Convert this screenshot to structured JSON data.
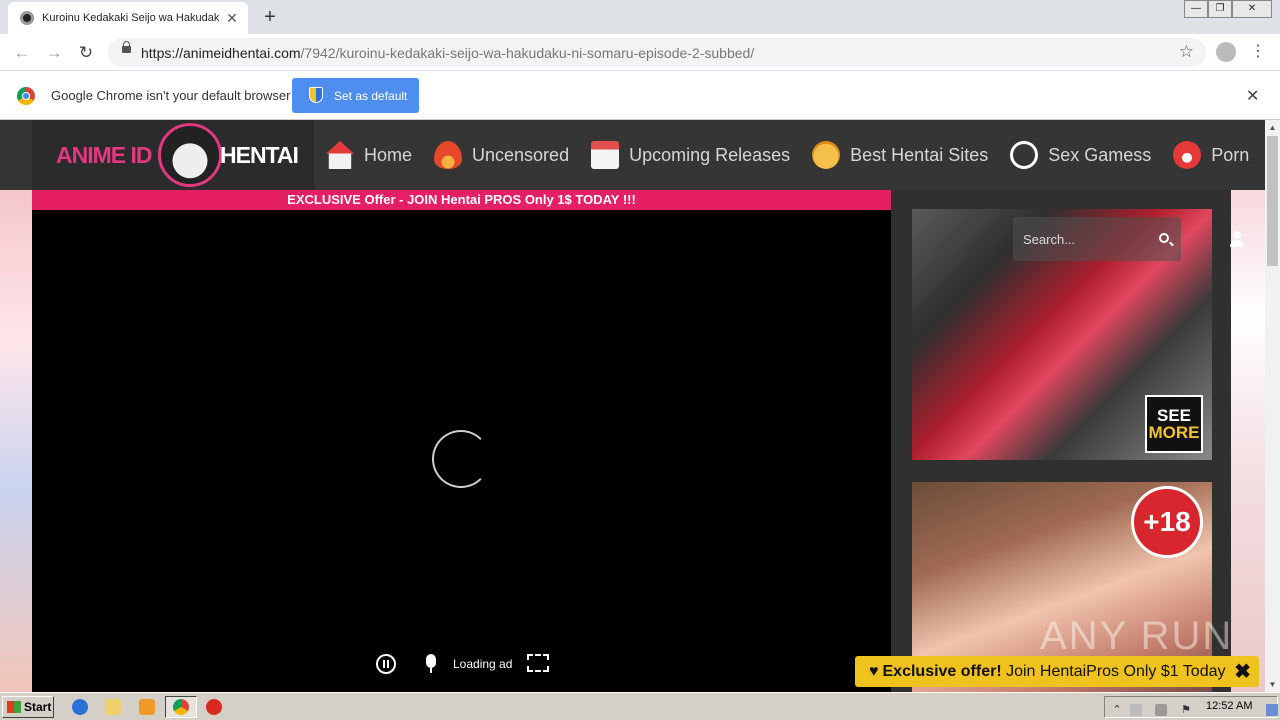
{
  "browser": {
    "tab_title": "Kuroinu Kedakaki Seijo wa Hakudaku ni Somaru",
    "tab_close": "✕",
    "new_tab": "+",
    "url_host": "https://animeidhentai.com",
    "url_path": "/7942/kuroinu-kedakaki-seijo-wa-hakudaku-ni-somaru-episode-2-subbed/",
    "back": "←",
    "forward": "→",
    "reload": "↻",
    "bookmark": "☆",
    "menu": "⋮",
    "window_minimize": "—",
    "window_restore": "❐",
    "window_close": "✕"
  },
  "infobar": {
    "message": "Google Chrome isn't your default browser",
    "button": "Set as default",
    "close": "✕"
  },
  "site": {
    "logo_left": "ANIME ID",
    "logo_right": "HENTAI",
    "nav": [
      {
        "label": "Home",
        "icon": "house-icon",
        "color": "#e33b3b"
      },
      {
        "label": "Uncensored",
        "icon": "fire-icon",
        "color": "#e8482a"
      },
      {
        "label": "Upcoming Releases",
        "icon": "calendar-icon",
        "color": "#e04e4e"
      },
      {
        "label": "Best Hentai Sites",
        "icon": "nerd-face-icon",
        "color": "#f0a12a"
      },
      {
        "label": "Sex Gamess",
        "icon": "nutaku-logo-icon",
        "color": "#ffffff"
      },
      {
        "label": "Porn",
        "icon": "flame-badge-icon",
        "color": "#e53838"
      }
    ],
    "offer_bar": "EXCLUSIVE Offer - JOIN Hentai PROS Only 1$ TODAY !!!",
    "player": {
      "loading_text": "Loading ad"
    },
    "search_placeholder": "Search...",
    "see_more_line1": "SEE",
    "see_more_line2": "MORE",
    "plus18": "+18",
    "watermark": "ANY RUN",
    "toast": {
      "prefix": "Exclusive offer!",
      "text": " Join HentaiPros Only $1 Today",
      "close": "✖"
    }
  },
  "taskbar": {
    "start": "Start",
    "clock": "12:52 AM"
  },
  "colors": {
    "accent_pink": "#e61e63",
    "toast_yellow": "#f0c21e",
    "chrome_blue": "#4d8ef0"
  }
}
